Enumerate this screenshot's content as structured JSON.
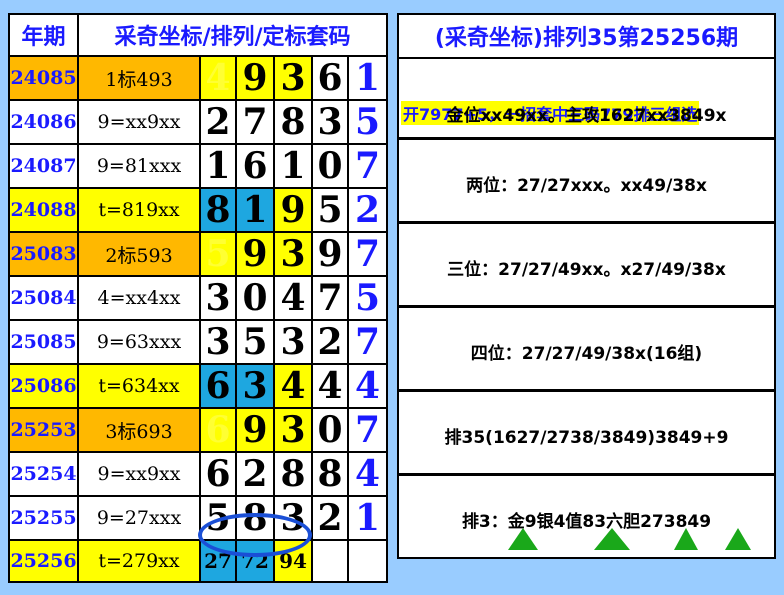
{
  "left": {
    "header": {
      "period": "年期",
      "desc": "采奇坐标/排列/定标套码"
    },
    "rows": [
      {
        "period": "24085",
        "desc": "1标493",
        "d": [
          "4",
          "9",
          "3",
          "6"
        ],
        "last": "1",
        "style": "orange",
        "d_bg": [
          "yellow",
          "yellow",
          "yellow",
          "white"
        ],
        "d_fg": [
          "ydig",
          "",
          "",
          ""
        ]
      },
      {
        "period": "24086",
        "desc": "9=xx9xx",
        "d": [
          "2",
          "7",
          "8",
          "3"
        ],
        "last": "5",
        "style": "white",
        "d_bg": [
          "white",
          "white",
          "white",
          "white"
        ],
        "d_fg": [
          "",
          "",
          "",
          ""
        ]
      },
      {
        "period": "24087",
        "desc": "9=81xxx",
        "d": [
          "1",
          "6",
          "1",
          "0"
        ],
        "last": "7",
        "style": "white",
        "d_bg": [
          "white",
          "white",
          "white",
          "white"
        ],
        "d_fg": [
          "",
          "",
          "",
          ""
        ]
      },
      {
        "period": "24088",
        "desc": "t=819xx",
        "d": [
          "8",
          "1",
          "9",
          "5"
        ],
        "last": "2",
        "style": "yellow",
        "d_bg": [
          "blue",
          "blue",
          "yellow",
          "white"
        ],
        "d_fg": [
          "",
          "",
          "",
          ""
        ]
      },
      {
        "period": "25083",
        "desc": "2标593",
        "d": [
          "5",
          "9",
          "3",
          "9"
        ],
        "last": "7",
        "style": "orange",
        "d_bg": [
          "yellow",
          "yellow",
          "yellow",
          "white"
        ],
        "d_fg": [
          "ydig",
          "",
          "",
          ""
        ]
      },
      {
        "period": "25084",
        "desc": "4=xx4xx",
        "d": [
          "3",
          "0",
          "4",
          "7"
        ],
        "last": "5",
        "style": "white",
        "d_bg": [
          "white",
          "white",
          "white",
          "white"
        ],
        "d_fg": [
          "",
          "",
          "",
          ""
        ]
      },
      {
        "period": "25085",
        "desc": "9=63xxx",
        "d": [
          "3",
          "5",
          "3",
          "2"
        ],
        "last": "7",
        "style": "white",
        "d_bg": [
          "white",
          "white",
          "white",
          "white"
        ],
        "d_fg": [
          "",
          "",
          "",
          ""
        ]
      },
      {
        "period": "25086",
        "desc": "t=634xx",
        "d": [
          "6",
          "3",
          "4",
          "4"
        ],
        "last": "4",
        "style": "yellow",
        "d_bg": [
          "blue",
          "blue",
          "yellow",
          "white"
        ],
        "d_fg": [
          "",
          "",
          "",
          ""
        ]
      },
      {
        "period": "25253",
        "desc": "3标693",
        "d": [
          "6",
          "9",
          "3",
          "0"
        ],
        "last": "7",
        "style": "orange",
        "d_bg": [
          "yellow",
          "yellow",
          "yellow",
          "white"
        ],
        "d_fg": [
          "ydig",
          "",
          "",
          ""
        ]
      },
      {
        "period": "25254",
        "desc": "9=xx9xx",
        "d": [
          "6",
          "2",
          "8",
          "8"
        ],
        "last": "4",
        "style": "white",
        "d_bg": [
          "white",
          "white",
          "white",
          "white"
        ],
        "d_fg": [
          "",
          "",
          "",
          ""
        ]
      },
      {
        "period": "25255",
        "desc": "9=27xxx",
        "d": [
          "5",
          "8",
          "3",
          "2"
        ],
        "last": "1",
        "style": "white",
        "d_bg": [
          "white",
          "white",
          "white",
          "white"
        ],
        "d_fg": [
          "",
          "",
          "",
          ""
        ]
      },
      {
        "period": "25256",
        "desc": "t=279xx",
        "d": [
          "27",
          "72",
          "94",
          ""
        ],
        "last": "",
        "style": "yellow",
        "d_bg": [
          "blue",
          "blue",
          "yellow",
          "white"
        ],
        "d_fg": [
          "small",
          "small",
          "small",
          ""
        ]
      }
    ]
  },
  "right": {
    "title": "(采奇坐标)排列35第25256期",
    "kai": "开7977+5，一招套中三码779排三组选",
    "boxes": [
      "金位xx49xx。主攻1627xx3849x",
      "两位：27/27xxx。xx49/38x",
      "三位：27/27/49xx。x27/49/38x",
      "四位：27/27/49/38x(16组)",
      "排35(1627/2738/3849)3849+9",
      "排3：金9银4值83六胆273849"
    ]
  }
}
